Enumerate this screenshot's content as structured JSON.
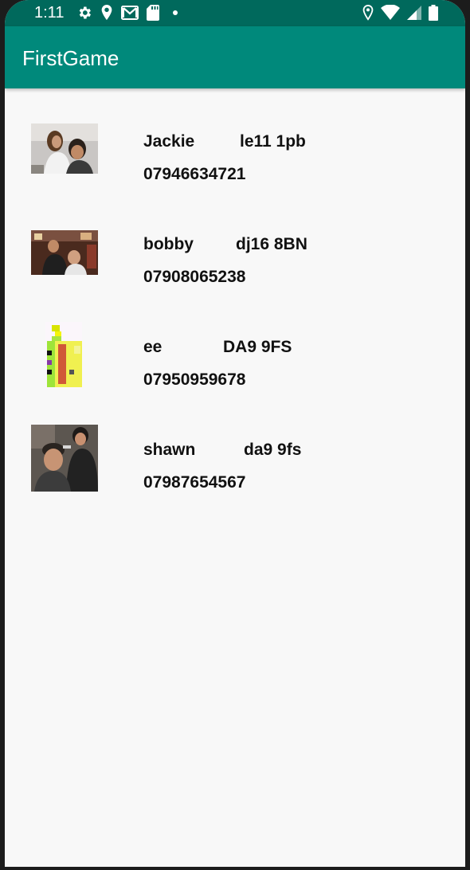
{
  "status_bar": {
    "time": "1:11",
    "left_icons": [
      "settings-icon",
      "location-icon",
      "gmail-icon",
      "sd-card-icon",
      "dot-icon"
    ],
    "right_icons": [
      "location-icon",
      "wifi-icon",
      "signal-icon",
      "battery-icon"
    ]
  },
  "app_bar": {
    "title": "FirstGame",
    "color": "#00897b",
    "status_color": "#00695c"
  },
  "contacts": [
    {
      "name": "Jackie",
      "postcode": "le11 1pb",
      "phone": "07946634721",
      "thumbnail": "barber-photo"
    },
    {
      "name": "bobby",
      "postcode": "dj16 8BN",
      "phone": "07908065238",
      "thumbnail": "barbershop-photo"
    },
    {
      "name": "ee",
      "postcode": "DA9 9FS",
      "phone": "07950959678",
      "thumbnail": "pixel-art-image"
    },
    {
      "name": "shawn",
      "postcode": "da9 9fs",
      "phone": "07987654567",
      "thumbnail": "haircut-photo"
    }
  ]
}
